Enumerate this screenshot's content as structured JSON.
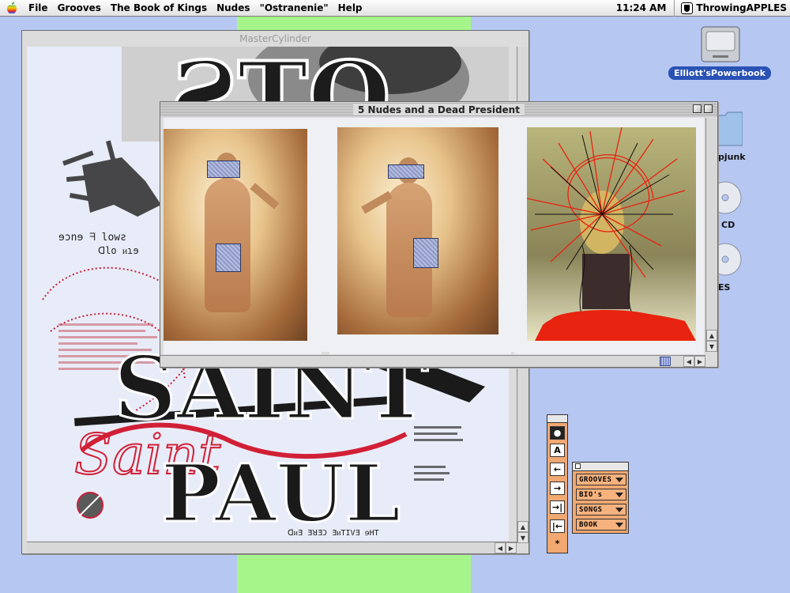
{
  "menubar": {
    "items": [
      "File",
      "Grooves",
      "The Book of Kings",
      "Nudes",
      "\"Ostranenie\"",
      "Help"
    ],
    "clock": "11:24 AM",
    "app_name": "ThrowingAPPLES"
  },
  "windows": {
    "back_title": "MasterCylinder",
    "front_title": "5 Nudes and a Dead President"
  },
  "desktop": {
    "hd_label": "Elliott'sPowerbook",
    "labels": [
      "pjunk",
      "CD",
      "ES"
    ]
  },
  "poster": {
    "reversed_text_1": "ɘɔnɘ ᖷ lowƨ",
    "reversed_text_2": "ᗡlo ᴎɿɘ",
    "reversed_text_3": "ᗡᴎƎ ƎꓤƎƆ ƎᴎTIVƎ ɘHT",
    "headline_top": "ƧTO",
    "headline_saint": "SAINT",
    "headline_paul": "PAUL"
  },
  "palette": {
    "buttons": [
      "●",
      "A",
      "←",
      "→",
      "→|",
      "|←",
      "*"
    ],
    "menus": [
      "GROOVES",
      "BIO's",
      "SONGS",
      "BOOK"
    ]
  },
  "colors": {
    "desktop": "#b6c7f2",
    "green_strip": "#a6f58a",
    "palette": "#f1a871",
    "hd_label_bg": "#2a52b5",
    "censor": "#8d99c9",
    "blood": "#e8230f"
  }
}
